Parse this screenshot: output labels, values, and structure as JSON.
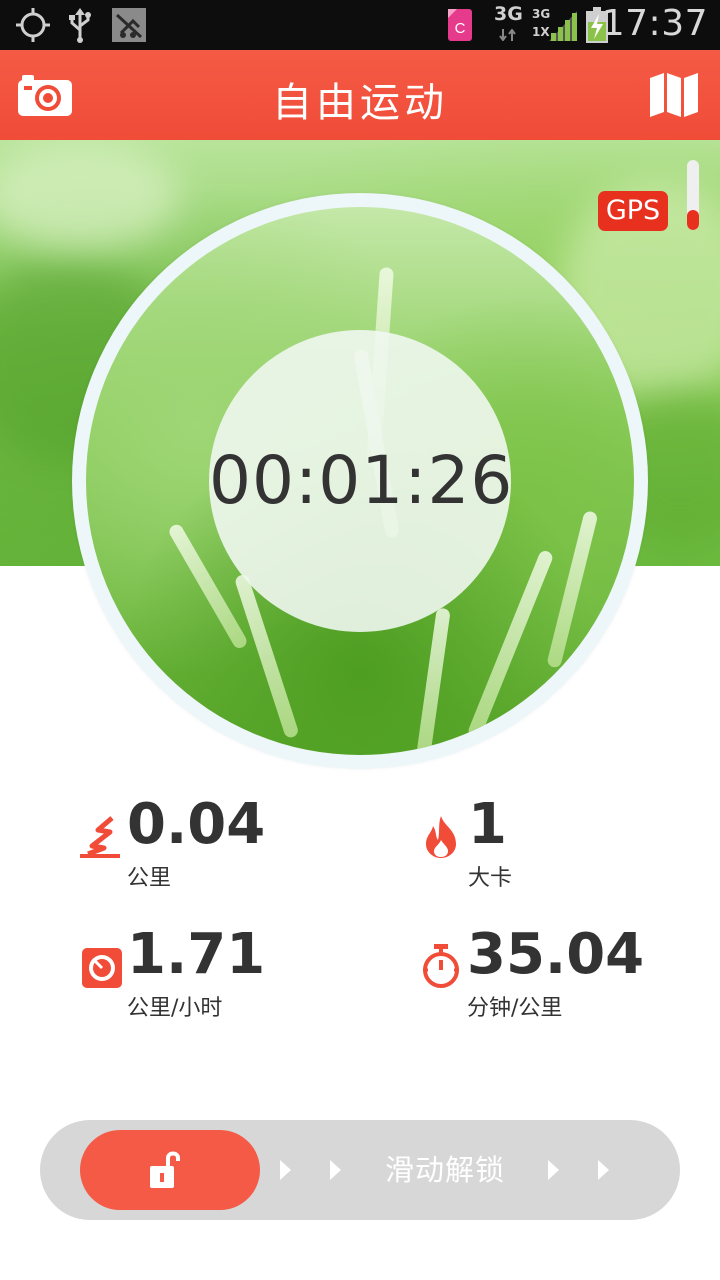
{
  "status_bar": {
    "time": "17:37",
    "network_primary": "3G",
    "network_secondary_top": "3G",
    "network_secondary_bottom": "1X",
    "icons": [
      "gps-crosshair-icon",
      "usb-icon",
      "app-notification-icon",
      "c-app-icon",
      "signal-icon",
      "battery-charging-icon"
    ]
  },
  "app_bar": {
    "title": "自由运动",
    "left_icon": "camera-icon",
    "right_icon": "map-icon"
  },
  "gps": {
    "label": "GPS",
    "signal_level": 0.28
  },
  "timer": {
    "elapsed": "00:01:26"
  },
  "stats": [
    {
      "icon": "distance-icon",
      "value": "0.04",
      "unit": "公里"
    },
    {
      "icon": "flame-icon",
      "value": "1",
      "unit": "大卡"
    },
    {
      "icon": "speedometer-icon",
      "value": "1.71",
      "unit": "公里/小时"
    },
    {
      "icon": "stopwatch-icon",
      "value": "35.04",
      "unit": "分钟/公里"
    }
  ],
  "unlock_slider": {
    "label": "滑动解锁",
    "knob_icon": "unlock-icon"
  },
  "colors": {
    "accent": "#f45a45",
    "gps_badge": "#e8301f",
    "text_dark": "#333333",
    "slider_track": "#d7d7d7"
  }
}
